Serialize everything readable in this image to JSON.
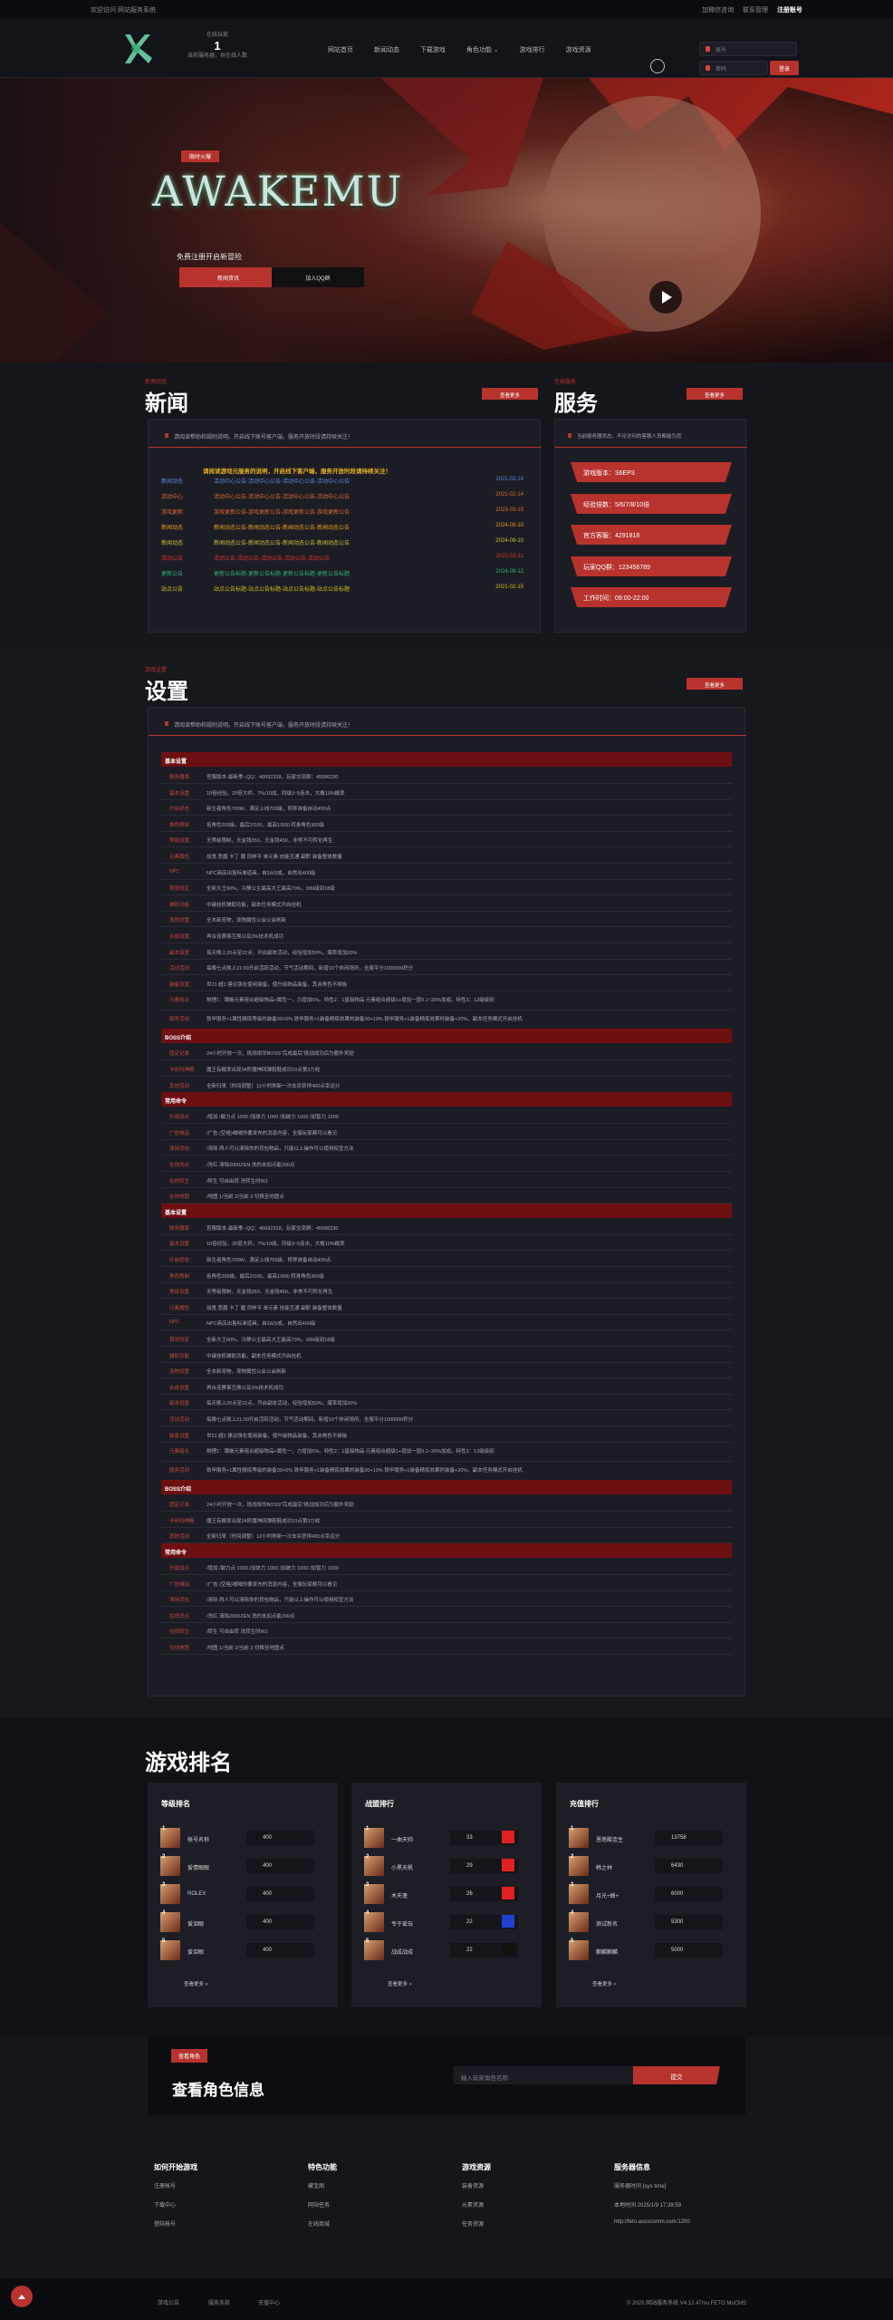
{
  "topbar": {
    "welcome": "欢迎访问 网站服务系统",
    "links": [
      "加微信咨询",
      "联系管理"
    ],
    "register": "注册账号"
  },
  "header": {
    "online_label": "在线玩家",
    "online_count": "1",
    "online_sub": "当前服务器，共在线人数",
    "nav": [
      "网站首页",
      "新闻动态",
      "下载游戏",
      "角色功能 ⌄",
      "游戏排行",
      "游戏资源"
    ],
    "user_placeholder": "账号",
    "pass_placeholder": "密码",
    "login": "登录"
  },
  "hero": {
    "badge": "限时火爆",
    "title": "AWAKEMU",
    "subtitle": "免费注册开启新冒险",
    "btn1": "新闻资讯",
    "btn2": "加入QQ群"
  },
  "news": {
    "label": "新闻动态",
    "title": "新闻",
    "more": "查看更多",
    "notice": "请阅读帮助和规则说明。开启线下账号客户端，服务开放时段请持续关注！",
    "headline": "请阅读游戏元服务的说明，开启线下客户端，服务开放时段请持续关注！",
    "rows": [
      {
        "cat": "新闻动态",
        "title": "活动中心公告-活动中心公告-活动中心公告-活动中心公告",
        "date": "2021-02-14",
        "c": "#5b8be0"
      },
      {
        "cat": "活动中心",
        "title": "活动中心公告-活动中心公告-活动中心公告-活动中心公告",
        "date": "2021-02-14",
        "c": "#e06a30"
      },
      {
        "cat": "游戏更新",
        "title": "游戏更新公告-游戏更新公告-游戏更新公告-游戏更新公告",
        "date": "2023-03-10",
        "c": "#e06a30"
      },
      {
        "cat": "新闻动态",
        "title": "新闻动态公告-新闻动态公告-新闻动态公告-新闻动态公告",
        "date": "2024-09-10",
        "c": "#e8a020"
      },
      {
        "cat": "新闻动态",
        "title": "新闻动态公告-新闻动态公告-新闻动态公告-新闻动态公告",
        "date": "2024-09-10",
        "c": "#c8c040"
      },
      {
        "cat": "活动公告",
        "title": "活动公告-活动公告-活动公告-活动公告-活动公告",
        "date": "2021-02-11",
        "c": "#e03030"
      },
      {
        "cat": "更新公告",
        "title": "更新公告标题-更新公告标题-更新公告标题-更新公告标题",
        "date": "2024-09-12",
        "c": "#30b080"
      },
      {
        "cat": "站点公告",
        "title": "站点公告标题-站点公告标题-站点公告标题-站点公告标题",
        "date": "2021-02-15",
        "c": "#d0c020"
      }
    ]
  },
  "service": {
    "label": "在线服务",
    "title": "服务",
    "more": "查看更多",
    "notice": "当前服务器状态，不论访问的客服人员都能为您",
    "items": [
      "游戏版本：S6EP3",
      "经验倍数：5/6/7/8/10倍",
      "官方客服：4291818",
      "玩家QQ群：123456789",
      "工作时间：09:00-22:00"
    ]
  },
  "settings": {
    "label": "游戏设置",
    "title": "设置",
    "more": "查看更多",
    "notice": "请阅读帮助和规则说明。开启线下账号客户端，服务开放时段请持续关注！",
    "blocks": [
      {
        "head": "基本设置",
        "rows": [
          [
            "服务器版",
            "官服版本-最新季--QQ：46692318，玩家交流群：45686230"
          ],
          [
            "基本设置",
            "10倍经验，20倍大师，7%/10成，同级3~5连击，大概10%概率"
          ],
          [
            "开启状态",
            "新生者角色700W，满足上线700级，转移准备自动400点"
          ],
          [
            "角色限制",
            "各角色200级，最后2/100，最高1/900 转身角色300级"
          ],
          [
            "等级设置",
            "无等级限制，无金钱350，无金钱450，非常不可转化再生"
          ],
          [
            "元素属性",
            "战鬼 恶魔 卡丁 魔 同样平 单元素 技能互通 副职 装备整体数量"
          ],
          [
            "NPC",
            "NPC商店出售标准道具，自3从5成，自然出400级"
          ],
          [
            "首领设定",
            "全新大王60%，冷静公主最高大王最高70%，999级到18级"
          ],
          [
            "辅助功能",
            "中键挂机辅助功能，副本任务模式开启挂机"
          ],
          [
            "宠物设置",
            "全本新宠物，宠物属性公会公会刷新"
          ],
          [
            "合成设置",
            "再合连赛事互换以及3%技术机成功"
          ],
          [
            "副本设置",
            "每天晚上20点至22点，开启副本活动，经验增加50%，爆率增加20%"
          ],
          [
            "活动活动",
            "每晚七点晚上21:00开启活跃活动，节气活动期间，新增10个休闲场所，全服平分1000000积分"
          ],
          [
            "装备设置",
            "世21 超2 建议强化使用装备，使升级物品装备，其余角色不掉板"
          ],
          [
            "元素组合",
            "物理1：镶嵌元素组合超级物品+属性一，力增加5%。特性2：1星级物品 元素组合超级1+增加一层0.1~20%加成。特性3：12级级别"
          ],
          [
            "服务活动",
            "铁甲服务+1属性精炼等级的装备30+5% 铁甲服务+1装备精炼效果的装备30+10% 铁甲服务+1装备精炼效果时装备+20%，副本任务模式开启挂机"
          ]
        ]
      },
      {
        "head": "BOSS介绍",
        "rows": [
          [
            "固定记录",
            "24小时开放一次，挑战相邻BOSS\"完成最后\"挑战成功后为额外奖励"
          ],
          [
            "卡利玛神殿",
            "魔王有概率出现34阶魔神回弹鞋鞋成功10点第3力收"
          ],
          [
            "其他活动",
            "全新归来（时间调整）12小时刷新一次击杀获得400点幸运分"
          ]
        ]
      },
      {
        "head": "常用命令",
        "rows": [
          [
            "升级加点",
            "/增加 /敏力点 1000 /加体力 1000 /加统力 1000 /加智力 1000"
          ],
          [
            "广告喊话",
            "/广告 (空格)喊喊你要发布的消息内容，全服玩家都可以看见"
          ],
          [
            "清除背包",
            "/清除 两人可以清除你的背包物品，只能以上操作可以使用权宜方法"
          ],
          [
            "在线洗点",
            "/洗红 清除2000ZEN 洗的未加点能200点"
          ],
          [
            "在线转生",
            "/转生 可自由转 洗转生时WJ"
          ],
          [
            "在线地图",
            "/地图 1/当前 2/当前 3 切换至地图点"
          ]
        ]
      },
      {
        "head": "基本设置",
        "rows": [
          [
            "服务器版",
            "官服版本-最新季--QQ：46692318，玩家交流群：45686230"
          ],
          [
            "基本设置",
            "10倍经验，20倍大师，7%/10成，同级3~5连击，大概10%概率"
          ],
          [
            "开启状态",
            "新生者角色700W，满足上线700级，转移准备自动400点"
          ],
          [
            "角色限制",
            "各角色200级，最后2/100，最高1/900 转身角色300级"
          ],
          [
            "等级设置",
            "无等级限制，无金钱350，无金钱450，非常不可转化再生"
          ],
          [
            "元素属性",
            "战鬼 恶魔 卡丁 魔 同样平 单元素 技能互通 副职 装备整体数量"
          ],
          [
            "NPC",
            "NPC商店出售标准道具，自3从5成，自然出400级"
          ],
          [
            "首领设定",
            "全新大王60%，冷静公主最高大王最高70%，999级到18级"
          ],
          [
            "辅助功能",
            "中键挂机辅助功能，副本任务模式开启挂机"
          ],
          [
            "宠物设置",
            "全本新宠物，宠物属性公会公会刷新"
          ],
          [
            "合成设置",
            "再合连赛事互换以及3%技术机成功"
          ],
          [
            "副本设置",
            "每天晚上20点至22点，开启副本活动，经验增加50%，爆率增加20%"
          ],
          [
            "活动活动",
            "每晚七点晚上21:00开启活跃活动，节气活动期间，新增10个休闲场所，全服平分1000000积分"
          ],
          [
            "装备设置",
            "世21 超2 建议强化使用装备，使升级物品装备，其余角色不掉板"
          ],
          [
            "元素组合",
            "物理1：镶嵌元素组合超级物品+属性一，力增加5%。特性2：1星级物品 元素组合超级1+增加一层0.1~20%加成。特性3：12级级别"
          ],
          [
            "服务活动",
            "铁甲服务+1属性精炼等级的装备30+5% 铁甲服务+1装备精炼效果的装备30+10% 铁甲服务+1装备精炼效果时装备+20%，副本任务模式开启挂机"
          ]
        ]
      },
      {
        "head": "BOSS介绍",
        "rows": [
          [
            "固定记录",
            "24小时开放一次，挑战相邻BOSS\"完成最后\"挑战成功后为额外奖励"
          ],
          [
            "卡利玛神殿",
            "魔王有概率出现34阶魔神回弹鞋鞋成功10点第3力收"
          ],
          [
            "其他活动",
            "全新归来（时间调整）12小时刷新一次击杀获得400点幸运分"
          ]
        ]
      },
      {
        "head": "常用命令",
        "rows": [
          [
            "升级加点",
            "/增加 /敏力点 1000 /加体力 1000 /加统力 1000 /加智力 1000"
          ],
          [
            "广告喊话",
            "/广告 (空格)喊喊你要发布的消息内容，全服玩家都可以看见"
          ],
          [
            "清除背包",
            "/清除 两人可以清除你的背包物品，只能以上操作可以使用权宜方法"
          ],
          [
            "在线洗点",
            "/洗红 清除2000ZEN 洗的未加点能200点"
          ],
          [
            "在线转生",
            "/转生 可自由转 洗转生时WJ"
          ],
          [
            "在线地图",
            "/地图 1/当前 2/当前 3 切换至地图点"
          ]
        ]
      }
    ]
  },
  "ranking": {
    "title": "游戏排名",
    "more": "查看更多 >",
    "cards": [
      {
        "title": "等级排名",
        "rows": [
          [
            "1",
            "帐号名称",
            "400"
          ],
          [
            "2",
            "爱情眼眼",
            "400"
          ],
          [
            "3",
            "ROLEX",
            "400"
          ],
          [
            "4",
            "爱泪眼",
            "400"
          ],
          [
            "5",
            "爱泪眼",
            "400"
          ]
        ]
      },
      {
        "title": "战盟排行",
        "rows": [
          [
            "1",
            "一曲天帅",
            "33"
          ],
          [
            "2",
            "小黑天帆",
            "29"
          ],
          [
            "3",
            "木天蓬",
            "26"
          ],
          [
            "4",
            "专于爱玩",
            "22"
          ],
          [
            "5",
            "战成战成",
            "22"
          ]
        ]
      },
      {
        "title": "充值排行",
        "rows": [
          [
            "1",
            "恩莲酸连生",
            "13758"
          ],
          [
            "2",
            "韩之林",
            "6430"
          ],
          [
            "3",
            "月光+蜂+",
            "6000"
          ],
          [
            "4",
            "测试新名",
            "5300"
          ],
          [
            "5",
            "麒麟麒麟",
            "5000"
          ]
        ]
      }
    ]
  },
  "query": {
    "badge": "查看角色",
    "title": "查看角色信息",
    "placeholder": "输入玩家角色名称",
    "button": "提交"
  },
  "footer": {
    "cols": [
      {
        "title": "如何开始游戏",
        "items": [
          "注册帐号",
          "下载中心",
          "登陆帐号"
        ]
      },
      {
        "title": "特色功能",
        "items": [
          "藏宝阁",
          "网站任务",
          "在线商城"
        ]
      },
      {
        "title": "游戏资源",
        "items": [
          "装备资源",
          "元素资源",
          "任务资源"
        ]
      },
      {
        "title": "服务器信息",
        "items": [
          "服务器时间 {sys time}",
          "本地时间 2025/1/9 17:38:59",
          "http://feto.asuscomm.com:1200"
        ]
      }
    ],
    "links": [
      "游戏公告",
      "服务条款",
      "充值中心"
    ],
    "copyright": "© 2025 网站服务系统 V4.12.47mu FETO MuCMS"
  }
}
